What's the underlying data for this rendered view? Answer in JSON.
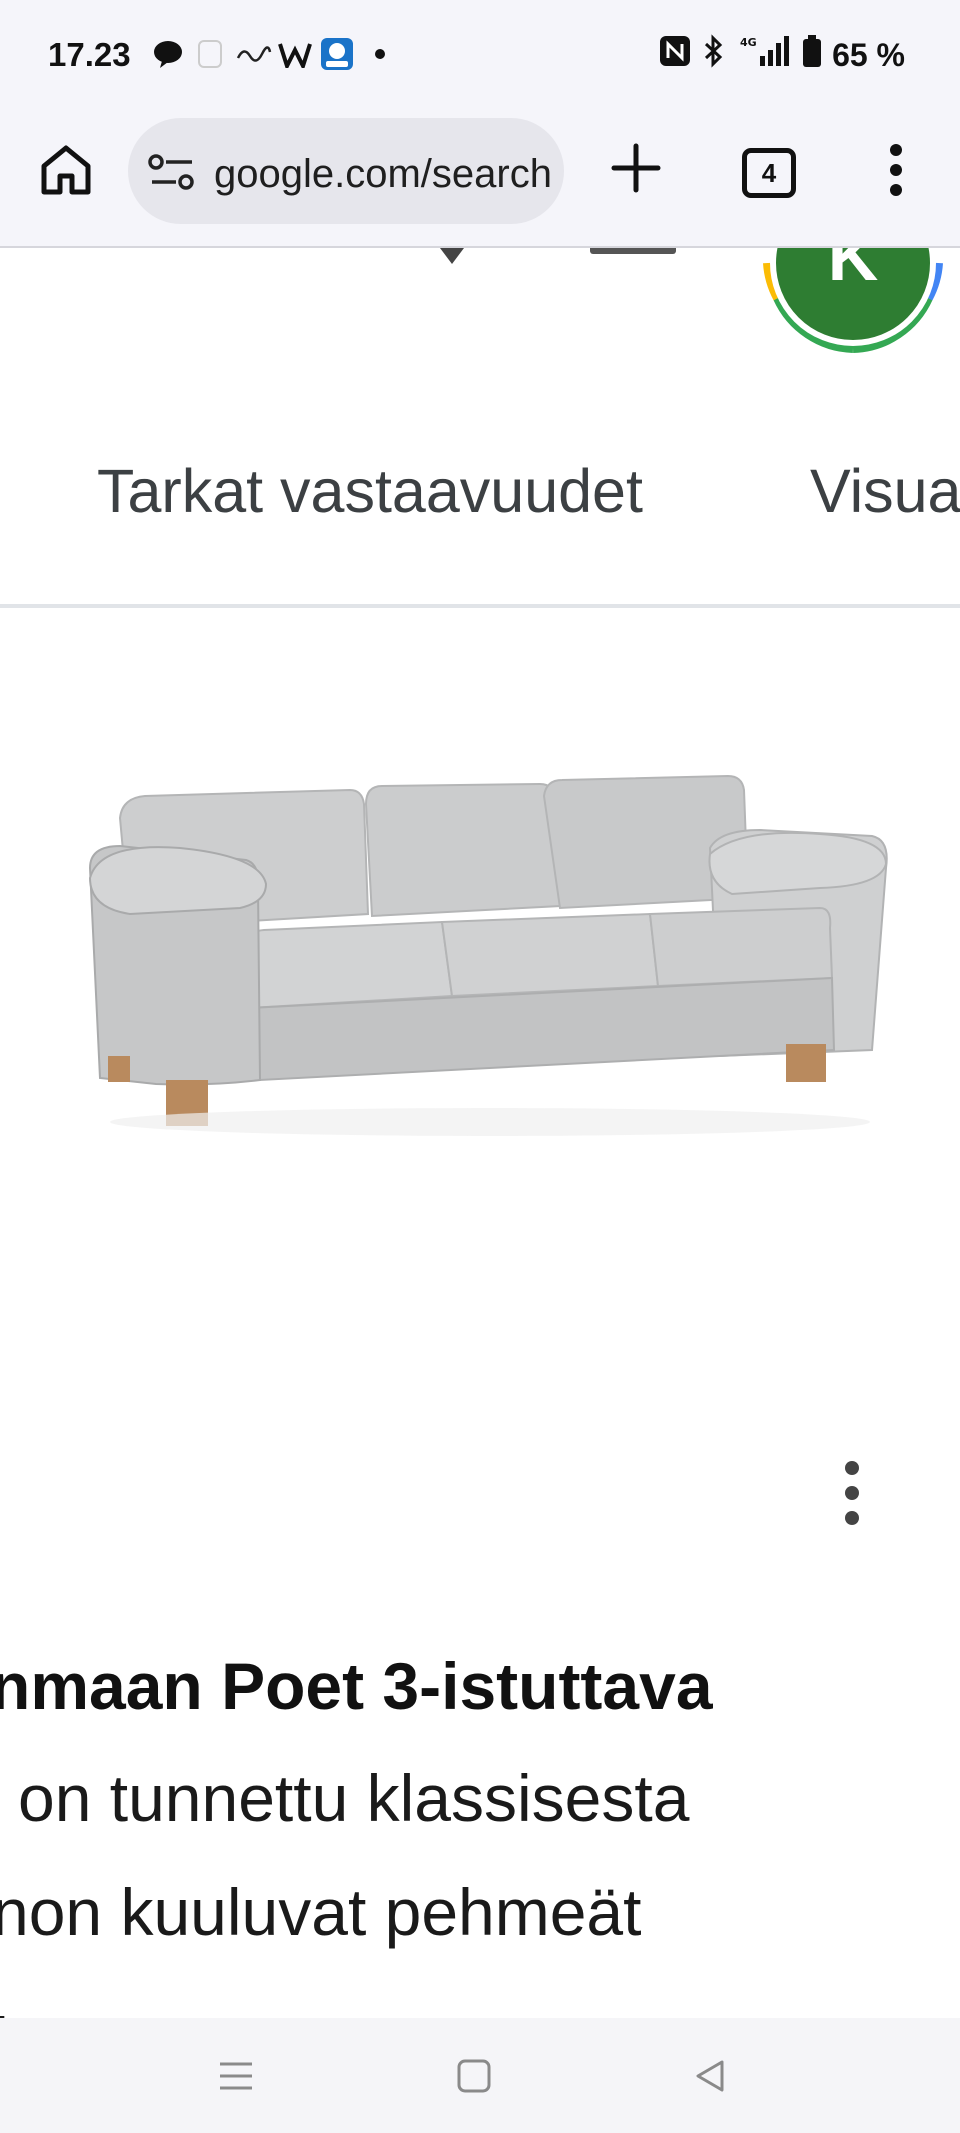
{
  "status_bar": {
    "time": "17.23",
    "battery": "65 %",
    "network": "4G",
    "icons": [
      "chat-icon",
      "download-icon",
      "elisa-icon",
      "wolt-icon",
      "lidl-plus-icon",
      "dot-icon",
      "nfc-icon",
      "bluetooth-icon",
      "signal-icon",
      "battery-icon"
    ]
  },
  "browser": {
    "url": "google.com/search",
    "tab_count": "4"
  },
  "page": {
    "avatar_initial": "K",
    "tabs": [
      {
        "label": "Tarkat vastaavuudet"
      },
      {
        "label": "Visuaaliset"
      }
    ],
    "product": {
      "image": "grey-three-seat-sofa-image",
      "title": "nmaan Poet 3-istuttava",
      "description_lines": [
        "on tunnettu klassisesta",
        "non kuuluvat pehmeät",
        ":"
      ]
    }
  },
  "colors": {
    "avatar": "#2e7d32",
    "sofa": "#c9cacc",
    "legs": "#b98a5e",
    "bars": "#f5f5fa"
  }
}
